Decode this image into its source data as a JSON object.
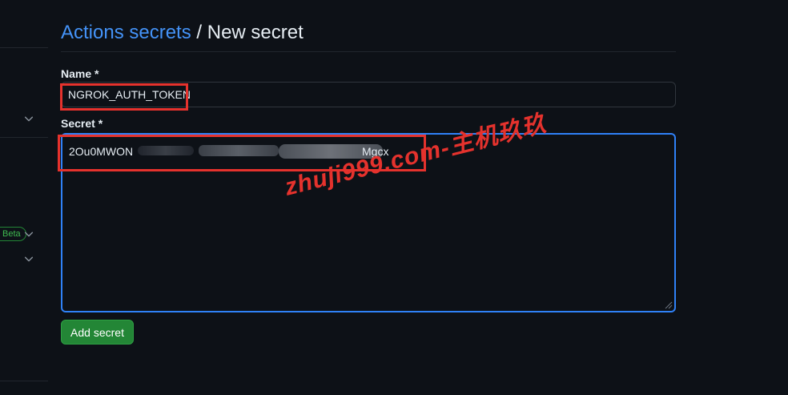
{
  "header": {
    "breadcrumb_link": "Actions secrets",
    "separator": " / ",
    "title": "New secret"
  },
  "sidebar": {
    "badge": "Beta",
    "icons": [
      "chevron-down-icon",
      "chevron-down-icon",
      "chevron-down-icon"
    ]
  },
  "form": {
    "name_label": "Name *",
    "name_value": "NGROK_AUTH_TOKEN",
    "secret_label": "Secret *",
    "secret_prefix": "2Ou0MWON",
    "secret_suffix": "Mgcx",
    "submit_label": "Add secret"
  },
  "watermark": "zhuji999.com-主机玖玖",
  "colors": {
    "background": "#0d1117",
    "link": "#4493f8",
    "focus_border": "#2f81f7",
    "primary_button": "#238636",
    "annotation_red": "#e5322d"
  }
}
